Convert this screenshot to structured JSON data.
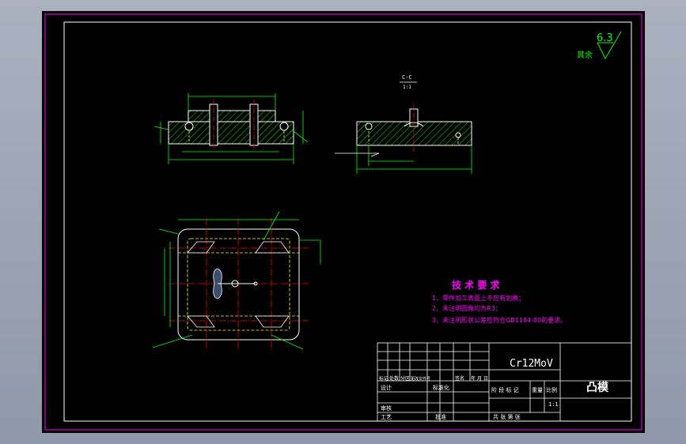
{
  "colors": {
    "sheet": "#000000",
    "border": "#ff00ff",
    "frame": "#ffffff",
    "outline": "#ffffff",
    "dimension": "#00ff00",
    "hatch": "#00ff00",
    "centerline": "#ff0000",
    "hidden": "#ffff00",
    "note_title": "#ff00ff",
    "note_text": "#ff00ff",
    "title_text": "#ffffff"
  },
  "roughness": {
    "value": "6.3",
    "label": "其余"
  },
  "section_view": {
    "label": "C-C",
    "scale": "1:1"
  },
  "tech_requirements": {
    "title": "技 术 要 求",
    "items": [
      "1、零件加工表面上不应有划痕；",
      "2、未注明圆角均为R3；",
      "3、未注明形状公差应符合GB1184-80的要求。"
    ]
  },
  "title_block": {
    "material": "Cr12MoV",
    "part_name": "凸模",
    "headers": [
      "标记",
      "处数",
      "分区",
      "更改文件号",
      "签名",
      "年 月 日"
    ],
    "design": "设计",
    "standardization": "标准化",
    "review": "审核",
    "process": "工艺",
    "approve": "批准",
    "stage_labels": [
      "阶 段 标 记",
      "重量",
      "比例"
    ],
    "scale": "1:1",
    "sheet_info": "共  张  第  张"
  }
}
